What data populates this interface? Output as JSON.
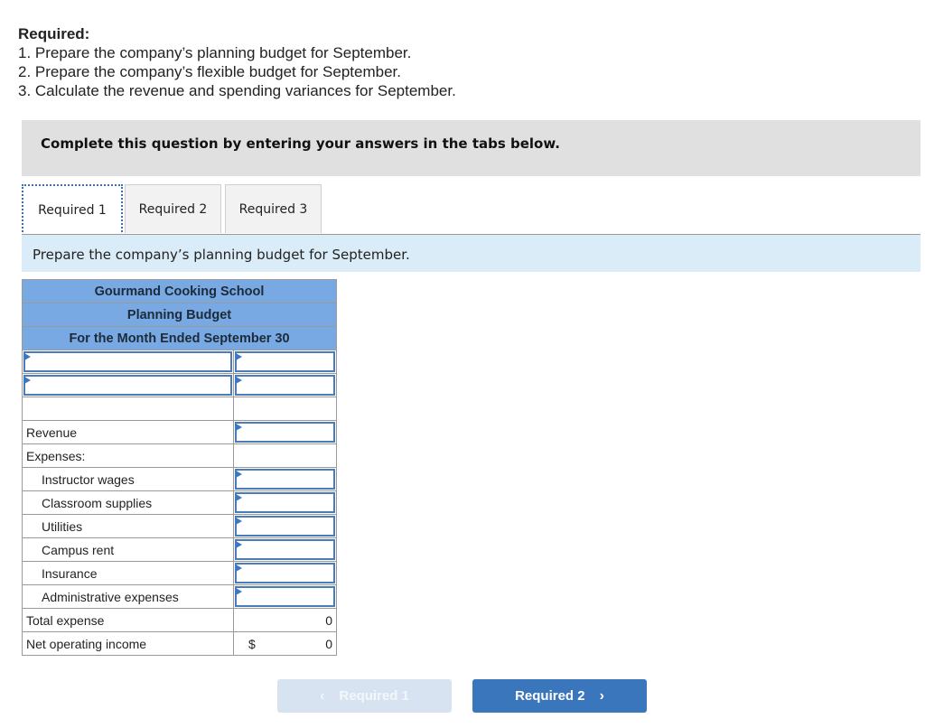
{
  "required": {
    "title": "Required:",
    "items": [
      "1. Prepare the company’s planning budget for September.",
      "2. Prepare the company’s flexible budget for September.",
      "3. Calculate the revenue and spending variances for September."
    ]
  },
  "banner": "Complete this question by entering your answers in the tabs below.",
  "tabs": [
    {
      "label": "Required 1",
      "active": true
    },
    {
      "label": "Required 2",
      "active": false
    },
    {
      "label": "Required 3",
      "active": false
    }
  ],
  "instruction": "Prepare the company’s planning budget for September.",
  "table": {
    "headers": [
      "Gourmand Cooking School",
      "Planning Budget",
      "For the Month Ended September 30"
    ],
    "rows": {
      "revenue": "Revenue",
      "expenses": "Expenses:",
      "instructor_wages": "Instructor wages",
      "classroom_supplies": "Classroom supplies",
      "utilities": "Utilities",
      "campus_rent": "Campus rent",
      "insurance": "Insurance",
      "administrative_expenses": "Administrative expenses",
      "total_expense": "Total expense",
      "net_operating_income": "Net operating income"
    },
    "total_expense_value": "0",
    "net_operating_income_currency": "$",
    "net_operating_income_value": "0"
  },
  "nav": {
    "prev_label": "Required 1",
    "next_label": "Required 2",
    "prev_icon": "‹",
    "next_icon": "›"
  }
}
